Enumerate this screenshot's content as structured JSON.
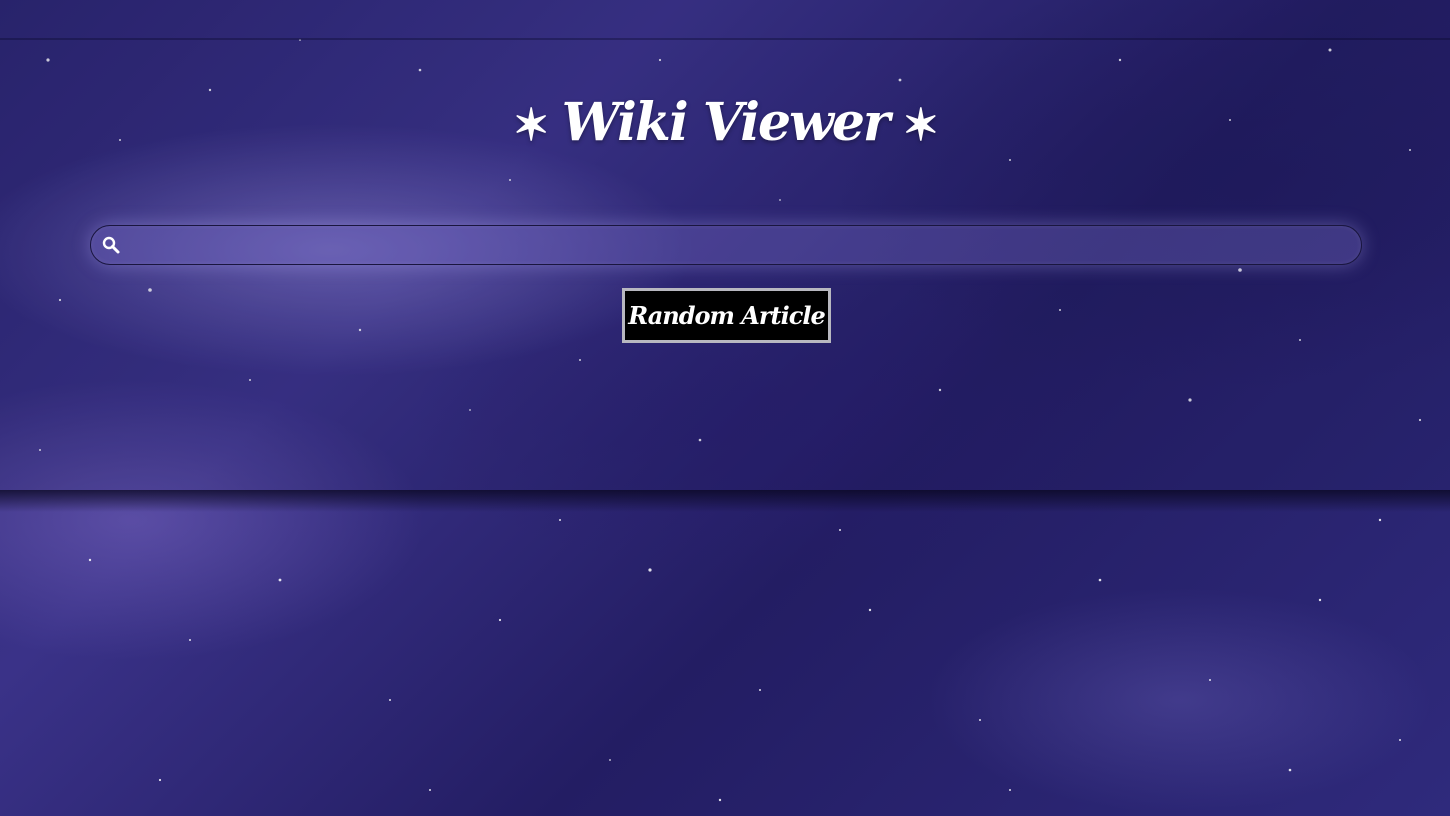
{
  "header": {
    "star_left": "✶",
    "title": "Wiki Viewer",
    "star_right": "✶"
  },
  "search": {
    "icon": "search-icon",
    "value": "",
    "placeholder": ""
  },
  "random_button": {
    "label": "Random Article"
  },
  "colors": {
    "background_primary": "#2b2570",
    "button_background": "#000000",
    "button_border": "#b8b8c0",
    "text": "#ffffff"
  }
}
